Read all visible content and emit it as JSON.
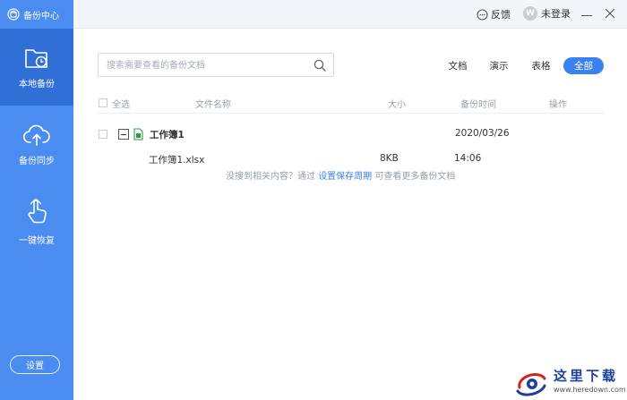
{
  "app": {
    "title": "备份中心"
  },
  "sidebar": {
    "items": [
      {
        "label": "本地备份",
        "icon": "folder-clock-icon",
        "active": true
      },
      {
        "label": "备份同步",
        "icon": "cloud-upload-icon",
        "active": false
      },
      {
        "label": "一键恢复",
        "icon": "hand-pointer-icon",
        "active": false
      }
    ],
    "settings_label": "设置"
  },
  "titlebar": {
    "feedback_label": "反馈",
    "login_label": "未登录"
  },
  "search": {
    "placeholder": "搜索需要查看的备份文档"
  },
  "filters": {
    "items": [
      "文档",
      "演示",
      "表格",
      "全部"
    ],
    "active": "全部"
  },
  "table": {
    "columns": {
      "select_all": "全选",
      "name": "文件名称",
      "size": "大小",
      "time": "备份时间",
      "action": "操作"
    },
    "group": {
      "name": "工作簿1",
      "date": "2020/03/26",
      "files": [
        {
          "name": "工作簿1.xlsx",
          "size": "8KB",
          "time": "14:06"
        }
      ]
    }
  },
  "empty_note": {
    "prefix": "没搜到相关内容？通过",
    "link": "设置保存周期",
    "suffix": "可查看更多备份文档"
  },
  "watermark": {
    "text": "这里下载",
    "url": "www.heredown.com"
  },
  "colors": {
    "sidebar": "#4b8cf0",
    "sidebar_active": "#2f6fd6",
    "accent": "#3b82f0"
  }
}
